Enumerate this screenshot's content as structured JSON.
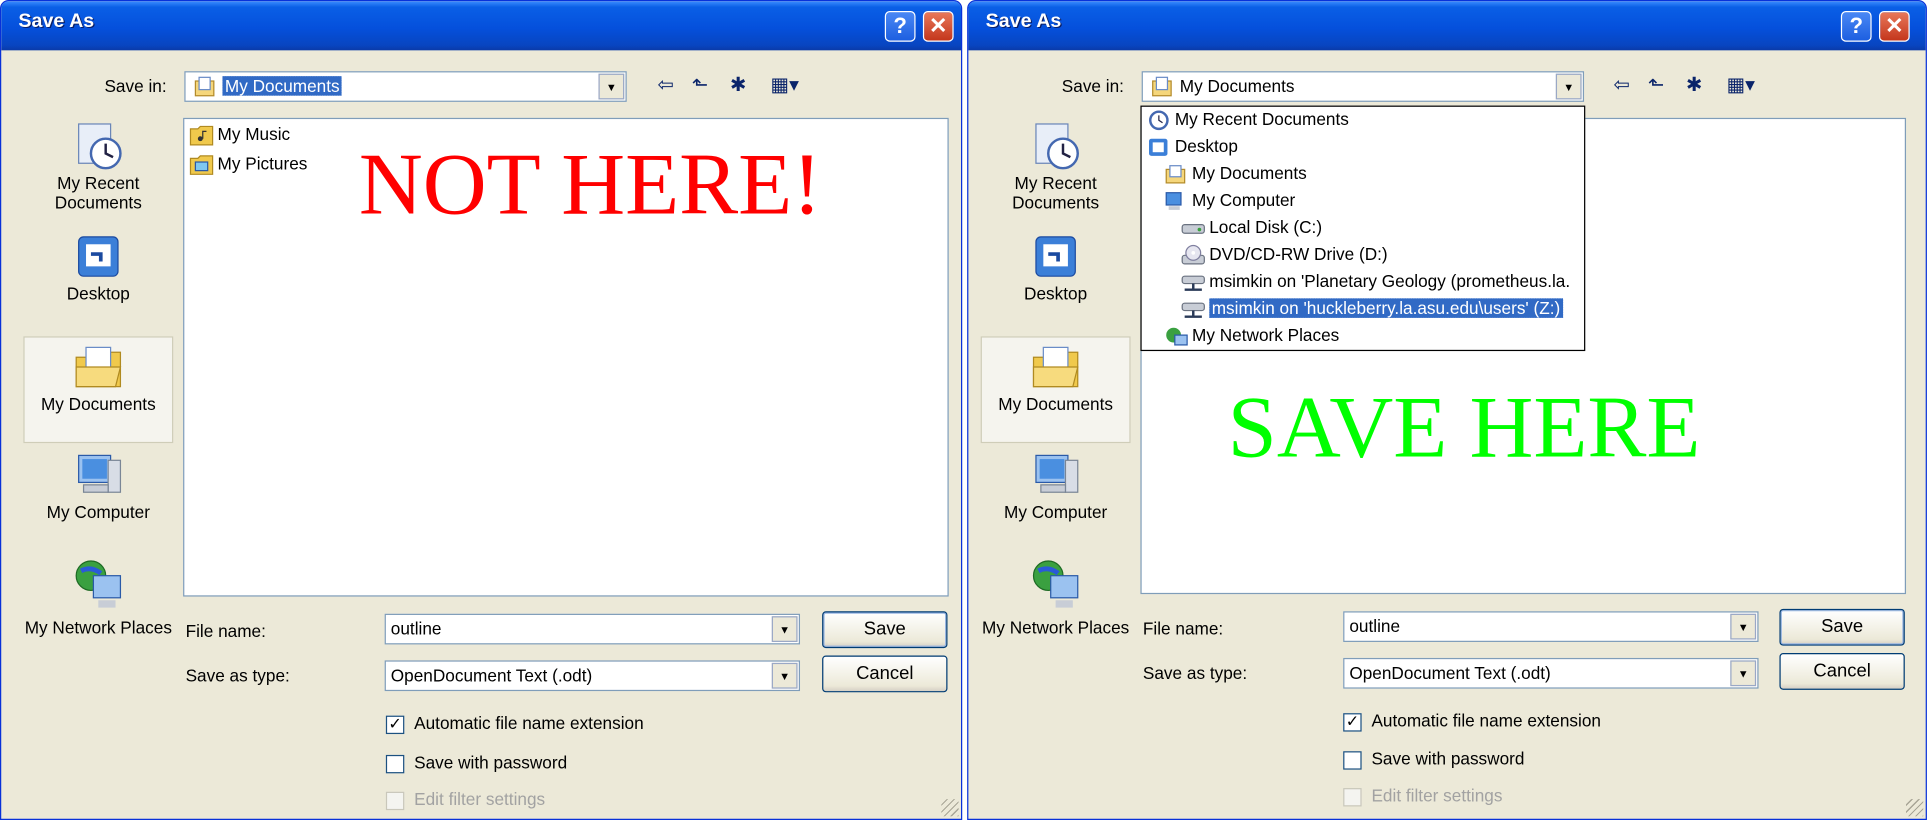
{
  "dialogs": [
    {
      "title": "Save As",
      "save_in_label": "Save in:",
      "save_in_value": "My Documents",
      "places": [
        "My Recent Documents",
        "Desktop",
        "My Documents",
        "My Computer",
        "My Network Places"
      ],
      "files": [
        "My Music",
        "My Pictures"
      ],
      "annotation": "NOT HERE!",
      "annotation_color": "#ff0000",
      "file_name_label": "File name:",
      "file_name_value": "outline",
      "save_as_type_label": "Save as type:",
      "save_as_type_value": "OpenDocument Text (.odt)",
      "save_button": "Save",
      "cancel_button": "Cancel",
      "checkboxes": [
        {
          "label": "Automatic file name extension",
          "checked": true,
          "enabled": true
        },
        {
          "label": "Save with password",
          "checked": false,
          "enabled": true
        },
        {
          "label": "Edit filter settings",
          "checked": false,
          "enabled": false
        }
      ]
    },
    {
      "title": "Save As",
      "save_in_label": "Save in:",
      "save_in_value": "My Documents",
      "places": [
        "My Recent Documents",
        "Desktop",
        "My Documents",
        "My Computer",
        "My Network Places"
      ],
      "annotation": "SAVE HERE",
      "annotation_color": "#00ff00",
      "file_name_label": "File name:",
      "file_name_value": "outline",
      "save_as_type_label": "Save as type:",
      "save_as_type_value": "OpenDocument Text (.odt)",
      "save_button": "Save",
      "cancel_button": "Cancel",
      "checkboxes": [
        {
          "label": "Automatic file name extension",
          "checked": true,
          "enabled": true
        },
        {
          "label": "Save with password",
          "checked": false,
          "enabled": true
        },
        {
          "label": "Edit filter settings",
          "checked": false,
          "enabled": false
        }
      ],
      "dropdown_items": [
        {
          "label": "My Recent Documents",
          "icon": "recent-documents-icon"
        },
        {
          "label": "Desktop",
          "icon": "desktop-icon"
        },
        {
          "label": "My Documents",
          "icon": "my-documents-icon"
        },
        {
          "label": "My Computer",
          "icon": "my-computer-icon"
        },
        {
          "label": "Local Disk (C:)",
          "icon": "local-disk-icon"
        },
        {
          "label": "DVD/CD-RW Drive (D:)",
          "icon": "dvd-drive-icon"
        },
        {
          "label": "msimkin on 'Planetary Geology (prometheus.la.",
          "icon": "network-drive-icon"
        },
        {
          "label": "msimkin on 'huckleberry.la.asu.edu\\users' (Z:)",
          "icon": "network-drive-icon",
          "selected": true
        },
        {
          "label": "My Network Places",
          "icon": "network-places-icon"
        }
      ]
    }
  ],
  "colors": {
    "titlebar": "#0550dc",
    "dialog_bg": "#ece9d8",
    "selection": "#316ac5"
  }
}
